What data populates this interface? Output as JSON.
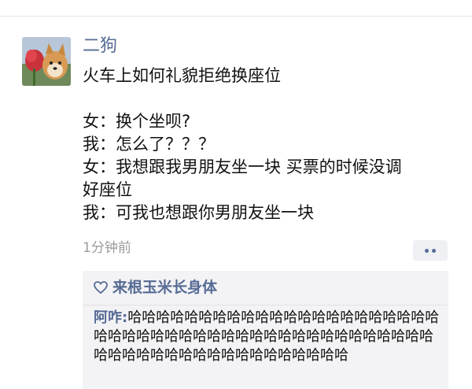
{
  "post": {
    "author": "二狗",
    "avatar_icon": "shiba-dog-with-red-flower-photo",
    "lines": [
      "火车上如何礼貌拒绝换座位",
      "",
      "女：换个坐呗?",
      "我：怎么了？？？",
      "女：我想跟我男朋友坐一块 买票的时候没调",
      "好座位",
      "我：可我也想跟你男朋友坐一块"
    ],
    "timestamp": "1分钟前",
    "more_icon": "two-dots-more-icon"
  },
  "interactions": {
    "heart_icon": "heart-outline-icon",
    "likes": "来根玉米长身体",
    "comment": {
      "author": "阿咋:",
      "text": "哈哈哈哈哈哈哈哈哈哈哈哈哈哈哈哈哈哈哈哈哈哈哈哈哈哈哈哈哈哈哈哈哈哈哈哈哈哈哈哈哈哈哈哈哈哈哈哈哈哈哈哈哈哈哈哈哈哈哈哈哈哈哈哈"
    }
  },
  "colors": {
    "link_blue": "#576b95",
    "panel_gray": "#f3f3f5",
    "time_gray": "#9b9b9b"
  }
}
